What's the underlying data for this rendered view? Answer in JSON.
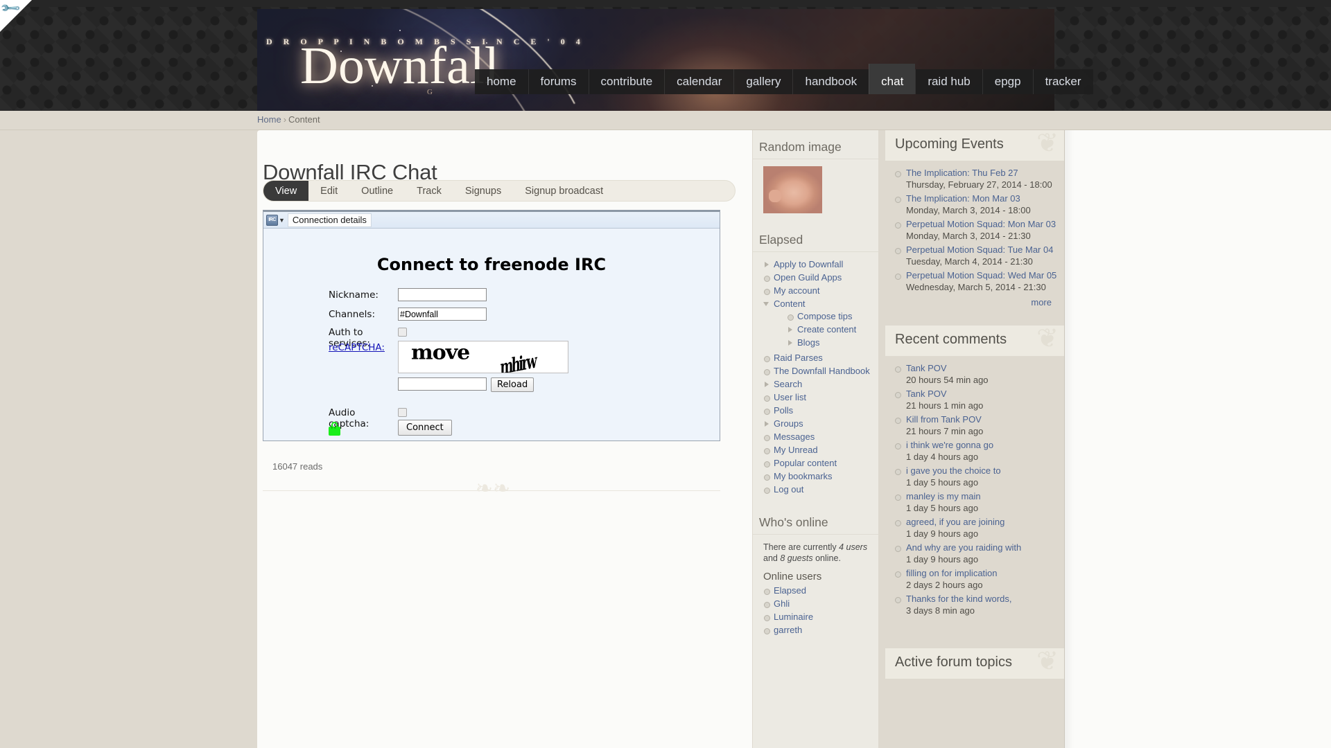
{
  "header": {
    "ribbon_icon": "wrench-icon",
    "banner": {
      "tagline": "D R O P P I N   B O M B S   S I N C E   ' 0 4",
      "title": "Downfall",
      "subtitle": "G"
    },
    "nav": [
      {
        "label": "home",
        "active": false
      },
      {
        "label": "forums",
        "active": false
      },
      {
        "label": "contribute",
        "active": false
      },
      {
        "label": "calendar",
        "active": false
      },
      {
        "label": "gallery",
        "active": false
      },
      {
        "label": "handbook",
        "active": false
      },
      {
        "label": "chat",
        "active": true
      },
      {
        "label": "raid hub",
        "active": false
      },
      {
        "label": "epgp",
        "active": false
      },
      {
        "label": "tracker",
        "active": false
      }
    ]
  },
  "breadcrumb": {
    "home": "Home",
    "separator": "›",
    "current": "Content"
  },
  "main": {
    "page_title": "Downfall IRC Chat",
    "tabs": [
      {
        "label": "View",
        "active": true
      },
      {
        "label": "Edit",
        "active": false
      },
      {
        "label": "Outline",
        "active": false
      },
      {
        "label": "Track",
        "active": false
      },
      {
        "label": "Signups",
        "active": false
      },
      {
        "label": "Signup broadcast",
        "active": false
      }
    ],
    "applet": {
      "badge_text": "IRC",
      "caret": "▼",
      "menu_item": "Connection details",
      "heading": "Connect to freenode IRC",
      "fields": {
        "nickname_label": "Nickname:",
        "nickname_value": "",
        "channels_label": "Channels:",
        "channels_value": "#Downfall",
        "auth_label": "Auth to services:",
        "auth_checked": false,
        "recaptcha_label": "reCAPTCHA:",
        "captcha_word_1": "move",
        "captcha_word_2": "mhirw",
        "captcha_answer_value": "",
        "reload_button": "Reload",
        "audio_captcha_label": "Audio captcha:",
        "audio_checked": false,
        "connect_button": "Connect",
        "lock_icon": "green-padlock-icon"
      }
    },
    "reads": "16047 reads",
    "divider_ornament": "❧❧"
  },
  "sidebar_mid": {
    "random_image": {
      "heading": "Random image",
      "image_alt": "newborn-baby-photo"
    },
    "elapsed": {
      "heading": "Elapsed",
      "items": [
        {
          "label": "Apply to Downfall",
          "bullet": "arrow"
        },
        {
          "label": "Open Guild Apps",
          "bullet": "dot"
        },
        {
          "label": "My account",
          "bullet": "dot"
        },
        {
          "label": "Content",
          "bullet": "down",
          "children": [
            {
              "label": "Compose tips",
              "bullet": "dot"
            },
            {
              "label": "Create content",
              "bullet": "arrow"
            },
            {
              "label": "Blogs",
              "bullet": "arrow"
            }
          ]
        },
        {
          "label": "Raid Parses",
          "bullet": "dot"
        },
        {
          "label": "The Downfall Handbook",
          "bullet": "dot"
        },
        {
          "label": "Search",
          "bullet": "arrow"
        },
        {
          "label": "User list",
          "bullet": "dot"
        },
        {
          "label": "Polls",
          "bullet": "dot"
        },
        {
          "label": "Groups",
          "bullet": "arrow"
        },
        {
          "label": "Messages",
          "bullet": "dot"
        },
        {
          "label": "My Unread",
          "bullet": "dot"
        },
        {
          "label": "Popular content",
          "bullet": "dot"
        },
        {
          "label": "My bookmarks",
          "bullet": "dot"
        },
        {
          "label": "Log out",
          "bullet": "dot"
        }
      ]
    },
    "whos_online": {
      "heading": "Who's online",
      "text_prefix": "There are currently ",
      "user_count": "4 users",
      "text_middle": " and ",
      "guest_count": "8 guests",
      "text_suffix": " online.",
      "online_users_heading": "Online users",
      "users": [
        "Elapsed",
        "Ghli",
        "Luminaire",
        "garreth"
      ]
    }
  },
  "sidebar_right": {
    "upcoming_events": {
      "heading": "Upcoming Events",
      "items": [
        {
          "title": "The Implication: Thu Feb 27",
          "meta": "Thursday, February 27, 2014 - 18:00"
        },
        {
          "title": "The Implication: Mon Mar 03",
          "meta": "Monday, March 3, 2014 - 18:00"
        },
        {
          "title": "Perpetual Motion Squad: Mon Mar 03",
          "meta": "Monday, March 3, 2014 - 21:30"
        },
        {
          "title": "Perpetual Motion Squad: Tue Mar 04",
          "meta": "Tuesday, March 4, 2014 - 21:30"
        },
        {
          "title": "Perpetual Motion Squad: Wed Mar 05",
          "meta": "Wednesday, March 5, 2014 - 21:30"
        }
      ],
      "more": "more"
    },
    "recent_comments": {
      "heading": "Recent comments",
      "items": [
        {
          "title": "Tank POV",
          "meta": "20 hours 54 min ago"
        },
        {
          "title": "Tank POV",
          "meta": "21 hours 1 min ago"
        },
        {
          "title": "Kill from Tank POV",
          "meta": "21 hours 7 min ago"
        },
        {
          "title": "i think we're gonna go",
          "meta": "1 day 4 hours ago"
        },
        {
          "title": "i gave you the choice to",
          "meta": "1 day 5 hours ago"
        },
        {
          "title": "manley is my main",
          "meta": "1 day 5 hours ago"
        },
        {
          "title": "agreed,  if you are joining",
          "meta": "1 day 9 hours ago"
        },
        {
          "title": "And why are you raiding with",
          "meta": "1 day 9 hours ago"
        },
        {
          "title": "filling on for implication",
          "meta": "2 days 2 hours ago"
        },
        {
          "title": "Thanks for the kind words,",
          "meta": "3 days 8 min ago"
        }
      ]
    },
    "active_forum_topics": {
      "heading": "Active forum topics"
    }
  },
  "colors": {
    "page_bg": "#ded9cf",
    "content_bg": "#fbfbf9",
    "header_dark": "#262626",
    "link_blue": "#4a6291",
    "tab_active_bg": "#3a3a3a",
    "applet_bg": "#eef4fb",
    "lock_green": "#1aee1a"
  }
}
